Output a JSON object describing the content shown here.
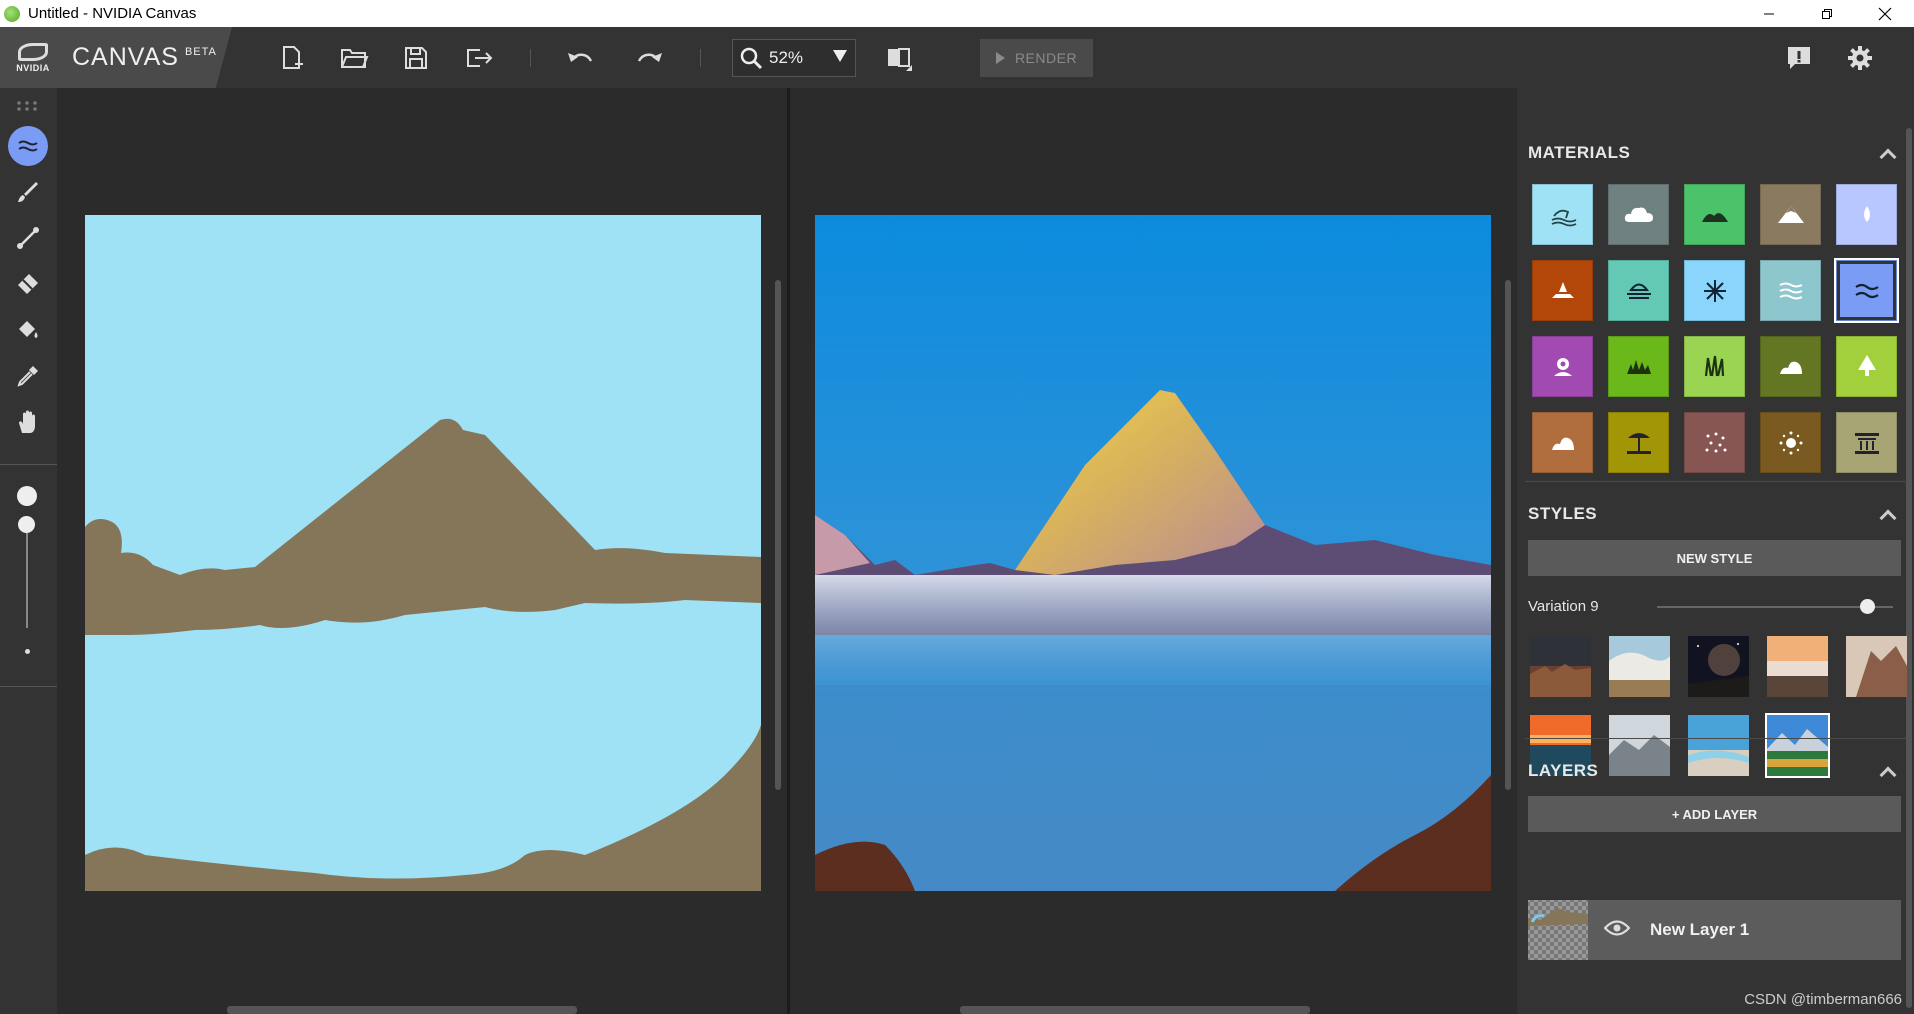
{
  "window": {
    "title": "Untitled - NVIDIA Canvas"
  },
  "brand": {
    "logo_text": "NVIDIA",
    "app_name": "CANVAS",
    "badge": "BETA"
  },
  "toolbar": {
    "zoom_value": "52%",
    "render_label": "RENDER"
  },
  "materials": {
    "title": "MATERIALS",
    "tiles": [
      {
        "name": "sea-icon",
        "color": "#9fe1f5"
      },
      {
        "name": "cloud-icon",
        "color": "#6f8080"
      },
      {
        "name": "hill-icon",
        "color": "#4cc26a"
      },
      {
        "name": "mountain-icon",
        "color": "#8a7a60"
      },
      {
        "name": "water-drop-icon",
        "color": "#b8c7ff"
      },
      {
        "name": "dirt-icon",
        "color": "#b3470a"
      },
      {
        "name": "fog-icon",
        "color": "#63c9b5"
      },
      {
        "name": "snow-icon",
        "color": "#8ad5fb"
      },
      {
        "name": "river-icon",
        "color": "#8dc6cd"
      },
      {
        "name": "water-icon",
        "color": "#7a9cf4"
      },
      {
        "name": "flower-icon",
        "color": "#a14ab1"
      },
      {
        "name": "grass-icon",
        "color": "#6bb81a"
      },
      {
        "name": "tall-grass-icon",
        "color": "#9bd452"
      },
      {
        "name": "rock-icon",
        "color": "#627623"
      },
      {
        "name": "tree-icon",
        "color": "#a2cf3c"
      },
      {
        "name": "stone-icon",
        "color": "#b06e3e"
      },
      {
        "name": "beach-icon",
        "color": "#a29607"
      },
      {
        "name": "gravel-icon",
        "color": "#875552"
      },
      {
        "name": "sand-icon",
        "color": "#7a5a21"
      },
      {
        "name": "building-icon",
        "color": "#a7a574"
      }
    ]
  },
  "styles": {
    "title": "STYLES",
    "new_style_label": "NEW STYLE",
    "variation_label": "Variation 9",
    "variation_level": 0.89,
    "thumbs": [
      "style-thumb-1",
      "style-thumb-2",
      "style-thumb-3",
      "style-thumb-4",
      "style-thumb-5",
      "style-thumb-6",
      "style-thumb-7",
      "style-thumb-8",
      "style-thumb-9"
    ]
  },
  "layers": {
    "title": "LAYERS",
    "add_layer_label": "+ ADD LAYER",
    "items": [
      {
        "label": "New Layer 1"
      }
    ]
  },
  "watermark": "CSDN @timberman666"
}
